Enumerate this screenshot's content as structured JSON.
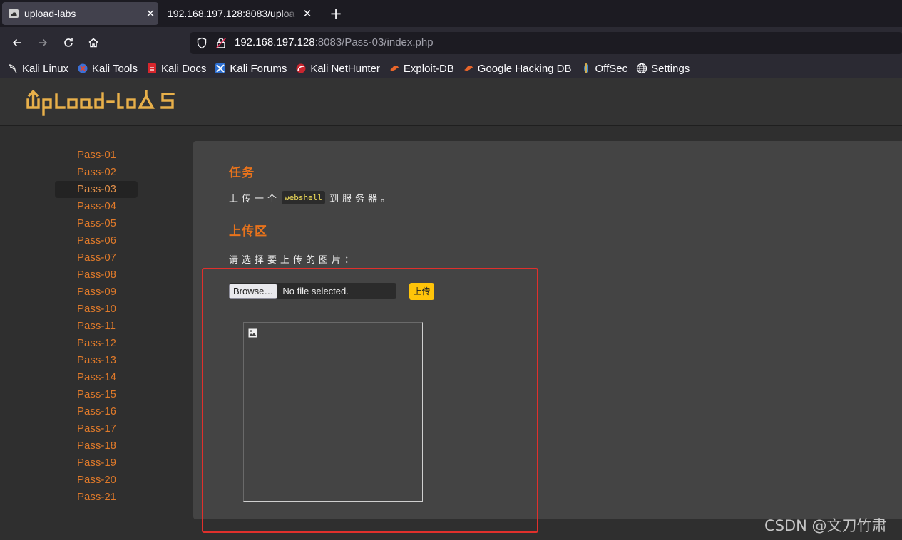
{
  "tabs": [
    {
      "title": "upload-labs",
      "close": "✕"
    },
    {
      "title": "192.168.197.128:8083/uploa",
      "close": "✕"
    }
  ],
  "new_tab": "+",
  "urlbar": {
    "host": "192.168.197.128",
    "rest": ":8083/Pass-03/index.php"
  },
  "bookmarks": [
    {
      "label": "Kali Linux",
      "icon": "kali-dragon-icon"
    },
    {
      "label": "Kali Tools",
      "icon": "kali-tools-icon"
    },
    {
      "label": "Kali Docs",
      "icon": "kali-docs-icon"
    },
    {
      "label": "Kali Forums",
      "icon": "kali-forums-icon"
    },
    {
      "label": "Kali NetHunter",
      "icon": "nethunter-icon"
    },
    {
      "label": "Exploit-DB",
      "icon": "exploitdb-icon"
    },
    {
      "label": "Google Hacking DB",
      "icon": "ghdb-icon"
    },
    {
      "label": "OffSec",
      "icon": "offsec-icon"
    },
    {
      "label": "Settings",
      "icon": "globe-icon"
    }
  ],
  "logo_text": "Upload-labs",
  "sidebar": [
    "Pass-01",
    "Pass-02",
    "Pass-03",
    "Pass-04",
    "Pass-05",
    "Pass-06",
    "Pass-07",
    "Pass-08",
    "Pass-09",
    "Pass-10",
    "Pass-11",
    "Pass-12",
    "Pass-13",
    "Pass-14",
    "Pass-15",
    "Pass-16",
    "Pass-17",
    "Pass-18",
    "Pass-19",
    "Pass-20",
    "Pass-21"
  ],
  "active_pass": "Pass-03",
  "task": {
    "heading": "任务",
    "before": "上传一个",
    "code": "webshell",
    "after": "到服务器。"
  },
  "upload": {
    "heading": "上传区",
    "prompt": "请选择要上传的图片：",
    "browse_label": "Browse…",
    "file_status": "No file selected.",
    "submit_label": "上传"
  },
  "watermark": "CSDN @文刀竹肃",
  "colors": {
    "accent": "#e8731c",
    "submit": "#ffc409",
    "highlight_box": "#e0302c"
  }
}
